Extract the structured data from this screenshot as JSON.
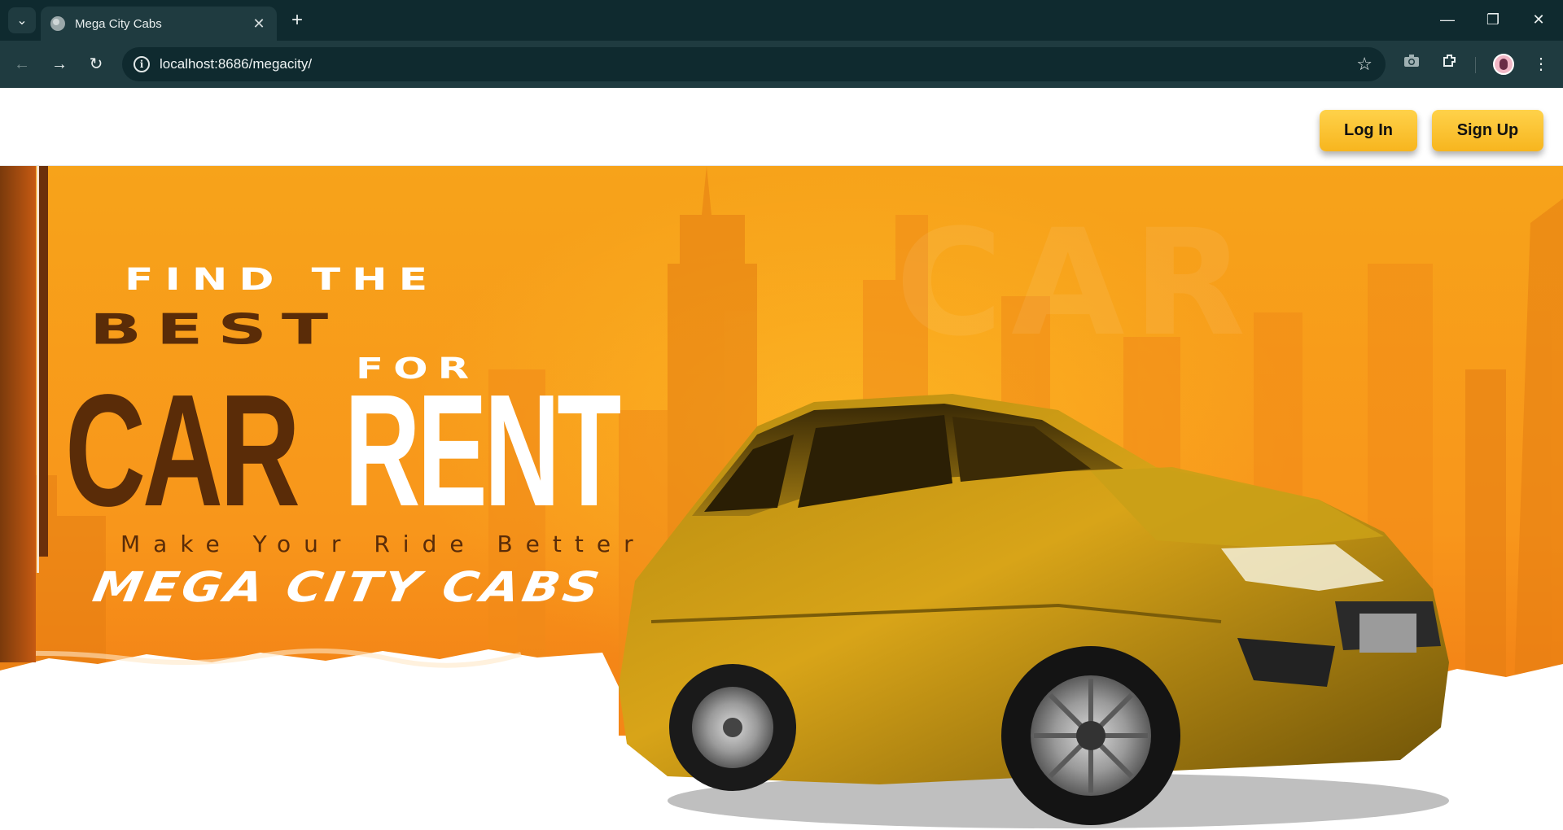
{
  "browser": {
    "tab_title": "Mega City Cabs",
    "tab_close": "✕",
    "new_tab": "+",
    "url": "localhost:8686/megacity/",
    "window_controls": {
      "minimize": "—",
      "restore": "❐",
      "close": "✕"
    },
    "nav": {
      "back": "←",
      "forward": "→",
      "reload": "↻"
    },
    "icons": {
      "info": "i",
      "star": "☆",
      "camera": "📷",
      "extensions": "⧉",
      "menu": "⋮",
      "tab_search": "⌄"
    }
  },
  "header": {
    "login_label": "Log In",
    "signup_label": "Sign Up"
  },
  "hero": {
    "line1": "FIND THE",
    "line2": "BEST",
    "line3": "FOR",
    "word_car": "CAR",
    "word_rent": "RENT",
    "tagline": "Make Your Ride Better",
    "brand": "MEGA CITY CABS"
  },
  "colors": {
    "accent_orange": "#f7a31a",
    "dark_brown": "#5a2c08",
    "button_yellow": "#ffd24a",
    "chrome_dark": "#0f2a2f",
    "chrome_mid": "#1f3b40"
  }
}
